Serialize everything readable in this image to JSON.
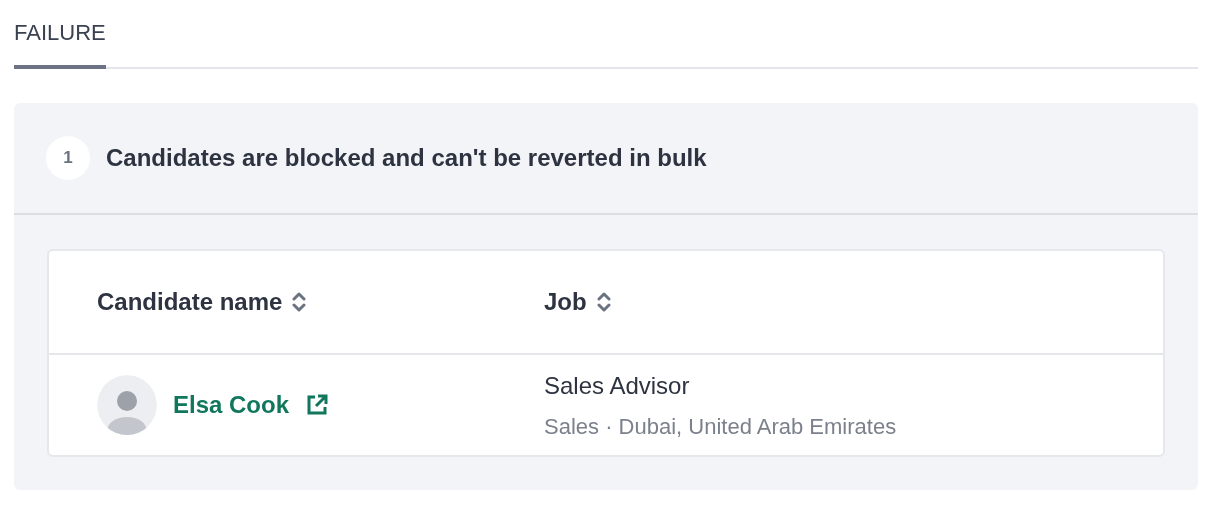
{
  "tabs": [
    {
      "label": "FAILURE",
      "selected": true
    }
  ],
  "failure_group": {
    "count": "1",
    "message": "Candidates are blocked and can't be reverted in bulk",
    "table": {
      "columns": [
        {
          "label": "Candidate name",
          "sortable": true
        },
        {
          "label": "Job",
          "sortable": true
        }
      ],
      "rows": [
        {
          "candidate": "Elsa Cook",
          "job_title": "Sales Advisor",
          "job_details": "Sales · Dubai, United Arab Emirates"
        }
      ]
    }
  }
}
